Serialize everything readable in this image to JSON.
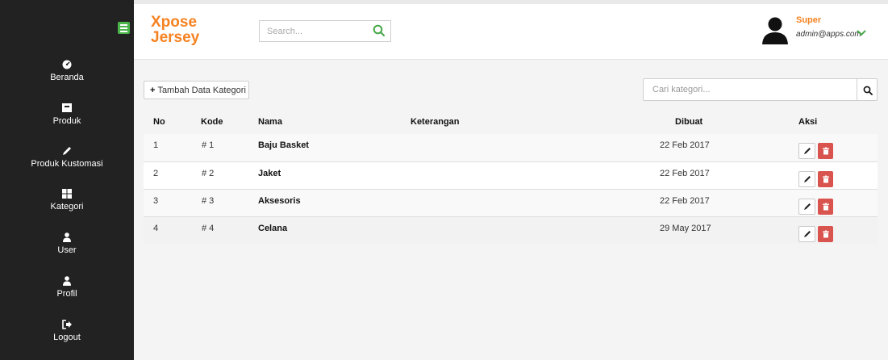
{
  "app": {
    "brand_line1": "Xpose",
    "brand_line2": "Jersey",
    "accent_color": "#f58220",
    "sidebar_bg": "#222222",
    "menu_toggle_color": "#49b54a",
    "delete_color": "#d9534f"
  },
  "header": {
    "search_placeholder": "Search...",
    "user_name": "Super",
    "user_email": "admin@apps.com"
  },
  "sidebar": {
    "items": [
      {
        "label": "Beranda",
        "icon": "dashboard-icon"
      },
      {
        "label": "Produk",
        "icon": "inbox-icon"
      },
      {
        "label": "Produk Kustomasi",
        "icon": "pencil-icon"
      },
      {
        "label": "Kategori",
        "icon": "grid-icon"
      },
      {
        "label": "User",
        "icon": "user-icon"
      },
      {
        "label": "Profil",
        "icon": "user-icon"
      },
      {
        "label": "Logout",
        "icon": "logout-icon"
      }
    ]
  },
  "toolbar": {
    "add_label": "Tambah Data Kategori",
    "search_placeholder": "Cari kategori..."
  },
  "table": {
    "headers": {
      "no": "No",
      "kode": "Kode",
      "nama": "Nama",
      "keterangan": "Keterangan",
      "dibuat": "Dibuat",
      "aksi": "Aksi"
    },
    "rows": [
      {
        "no": "1",
        "kode": "# 1",
        "nama": "Baju Basket",
        "keterangan": "",
        "dibuat": "22 Feb 2017"
      },
      {
        "no": "2",
        "kode": "# 2",
        "nama": "Jaket",
        "keterangan": "",
        "dibuat": "22 Feb 2017"
      },
      {
        "no": "3",
        "kode": "# 3",
        "nama": "Aksesoris",
        "keterangan": "",
        "dibuat": "22 Feb 2017"
      },
      {
        "no": "4",
        "kode": "# 4",
        "nama": "Celana",
        "keterangan": "",
        "dibuat": "29 May 2017"
      }
    ]
  }
}
